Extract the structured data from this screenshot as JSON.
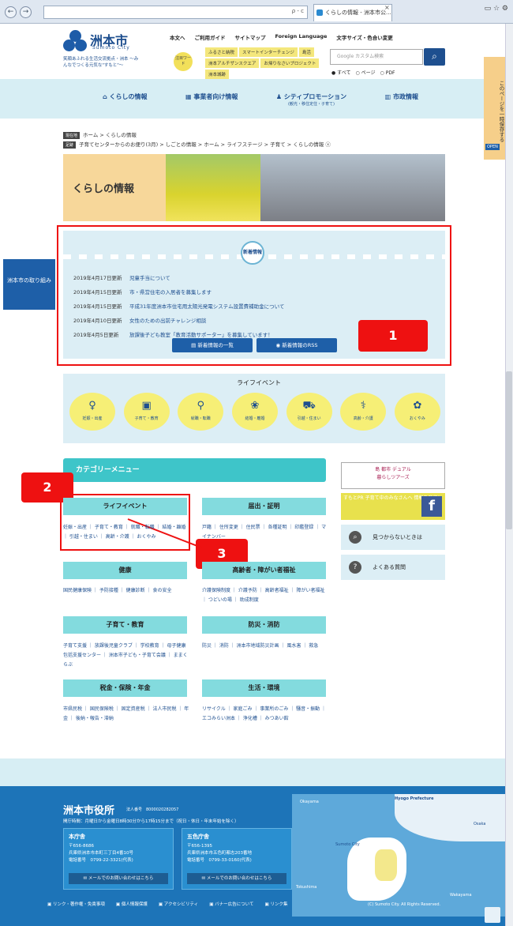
{
  "browser": {
    "tab_title": "くらしの情報 - 洲本市公...",
    "tab_close": "×",
    "back": "←",
    "forward": "→",
    "search_glyph": "ρ - c"
  },
  "header": {
    "logo_name": "洲本市",
    "logo_sub": "Sumoto City",
    "logo_tagline": "笑顔あふれる生活交流拠点・洲本 〜みんなでつくる元気な\"すもと\"〜",
    "top_links": [
      "本文へ",
      "ご利用ガイド",
      "サイトマップ",
      "Foreign Language",
      "文字サイズ・色合い変更"
    ],
    "featured_label": "注目ワード",
    "hot_keywords": [
      "ふるさと納税",
      "スマートインターチェンジ",
      "島活",
      "洲本アルチザンスクエア",
      "お帰りなさいプロジェクト",
      "洲本城跡"
    ],
    "search_placeholder": "Google カスタム検索",
    "search_options": [
      "すべて",
      "ページ",
      "PDF"
    ],
    "nav": [
      {
        "label": "くらしの情報",
        "sub": ""
      },
      {
        "label": "事業者向け情報",
        "sub": ""
      },
      {
        "label": "シティプロモーション",
        "sub": "(観光・移住定住・子育て)"
      },
      {
        "label": "市政情報",
        "sub": ""
      }
    ],
    "side_tab": "このページを一時保存する",
    "side_tab_badge": "OPEN"
  },
  "breadcrumb": {
    "current_label": "現在地",
    "current_path": "ホーム > くらしの情報",
    "history_label": "足跡",
    "history_path": "子育てセンターからのお便り(3月) > しごとの情報 > ホーム > ライフステージ > 子育て > くらしの情報"
  },
  "hero": {
    "title": "くらしの情報"
  },
  "news": {
    "badge": "新着情報",
    "items": [
      {
        "date": "2019年4月17日更新",
        "title": "児童手当について"
      },
      {
        "date": "2019年4月15日更新",
        "title": "市・県営住宅の入居者を募集します"
      },
      {
        "date": "2019年4月15日更新",
        "title": "平成31年度洲本市住宅用太陽光発電システム設置費補助金について"
      },
      {
        "date": "2019年4月10日更新",
        "title": "女性のための出前チャレンジ相談"
      },
      {
        "date": "2019年4月5日更新",
        "title": "放課後子ども教室「教育活動サポーター」を募集しています！"
      }
    ],
    "btn_list": "新着情報の一覧",
    "btn_rss": "新着情報のRSS"
  },
  "left_tab": "洲本市の取り組み",
  "markers": [
    "1",
    "2",
    "3"
  ],
  "life_events": {
    "title": "ライフイベント",
    "items": [
      {
        "label": "妊娠・出産",
        "icon": "♀"
      },
      {
        "label": "子育て・教育",
        "icon": "▣"
      },
      {
        "label": "就職・転職",
        "icon": "⚲"
      },
      {
        "label": "結婚・離婚",
        "icon": "❀"
      },
      {
        "label": "引越・住まい",
        "icon": "⛟"
      },
      {
        "label": "高齢・介護",
        "icon": "⚕"
      },
      {
        "label": "おくやみ",
        "icon": "✿"
      }
    ]
  },
  "category": {
    "title": "カテゴリーメニュー",
    "blocks": [
      {
        "title": "ライフイベント",
        "links": "妊娠・出産 ｜ 子育て・教育 ｜ 就職・転職 ｜ 結婚・離婚 ｜ 引越・住まい ｜ 高齢・介護 ｜ おくやみ"
      },
      {
        "title": "届出・証明",
        "links": "戸籍 ｜ 住所変更 ｜ 住民票 ｜ 各種証明 ｜ 印鑑登録 ｜ マイナンバー"
      },
      {
        "title": "健康",
        "links": "国民健康保険 ｜ 予防接種 ｜ 健康診断 ｜ 食の安全"
      },
      {
        "title": "高齢者・障がい者福祉",
        "links": "介護保険制度 ｜ 介護予防 ｜ 高齢者福祉 ｜ 障がい者福祉 ｜ つどいの場 ｜ 助成制度"
      },
      {
        "title": "子育て・教育",
        "links": "子育て支援 ｜ 放課後児童クラブ ｜ 学校教育 ｜ 母子健康包括支援センター ｜ 洲本市子ども・子育て会議 ｜ ままくらぶ"
      },
      {
        "title": "防災・消防",
        "links": "防災 ｜ 消防 ｜ 洲本市地域防災計画 ｜ 風水害 ｜ 救急"
      },
      {
        "title": "税金・保険・年金",
        "links": "市県民税 ｜ 国民保険税 ｜ 固定資産税 ｜ 法人市民税 ｜ 年金 ｜ 後納・報告・滞納"
      },
      {
        "title": "生活・環境",
        "links": "リサイクル ｜ 家庭ごみ ｜ 事業所のごみ ｜ 騒音・振動 ｜ エコみらい洲本 ｜ 浄化槽 ｜ みつあい館"
      }
    ]
  },
  "right_col": {
    "banner1_main": "島 都市 デュアル",
    "banner1_sub": "暮らしツアーズ",
    "banner2": "すもとPR 子育て中のみなさんへ 情報を発信！",
    "banner2_fb": "f",
    "notfound": "見つからないときは",
    "faq": "よくある質問"
  },
  "footer": {
    "title": "洲本市役所",
    "corp_number": "法人番号　8000020282057",
    "hours": "開庁時間：月曜日から金曜日8時30分から17時15分まで（祝日・休日・年末年始を除く）",
    "offices": [
      {
        "name": "本庁舎",
        "zip": "〒656-8686",
        "addr": "兵庫県洲本市本町三丁目4番10号",
        "tel": "電話番号　0799-22-3321(代表)",
        "mail": "メールでのお問い合わせはこちら"
      },
      {
        "name": "五色庁舎",
        "zip": "〒656-1395",
        "addr": "兵庫県洲本市五色町都志203番地",
        "tel": "電話番号　0799-33-0160(代表)",
        "mail": "メールでのお問い合わせはこちら"
      }
    ],
    "map_labels": [
      "Hyogo Prefecture",
      "Sumoto City",
      "Okayama",
      "Osaka",
      "Tokushima",
      "Wakayama"
    ],
    "links": [
      "リンク・著作権・免責事項",
      "個人情報保護",
      "アクセシビリティ",
      "バナー広告について",
      "リンク集"
    ],
    "copyright": "(C) Sumoto City. All Rights Reserved."
  }
}
